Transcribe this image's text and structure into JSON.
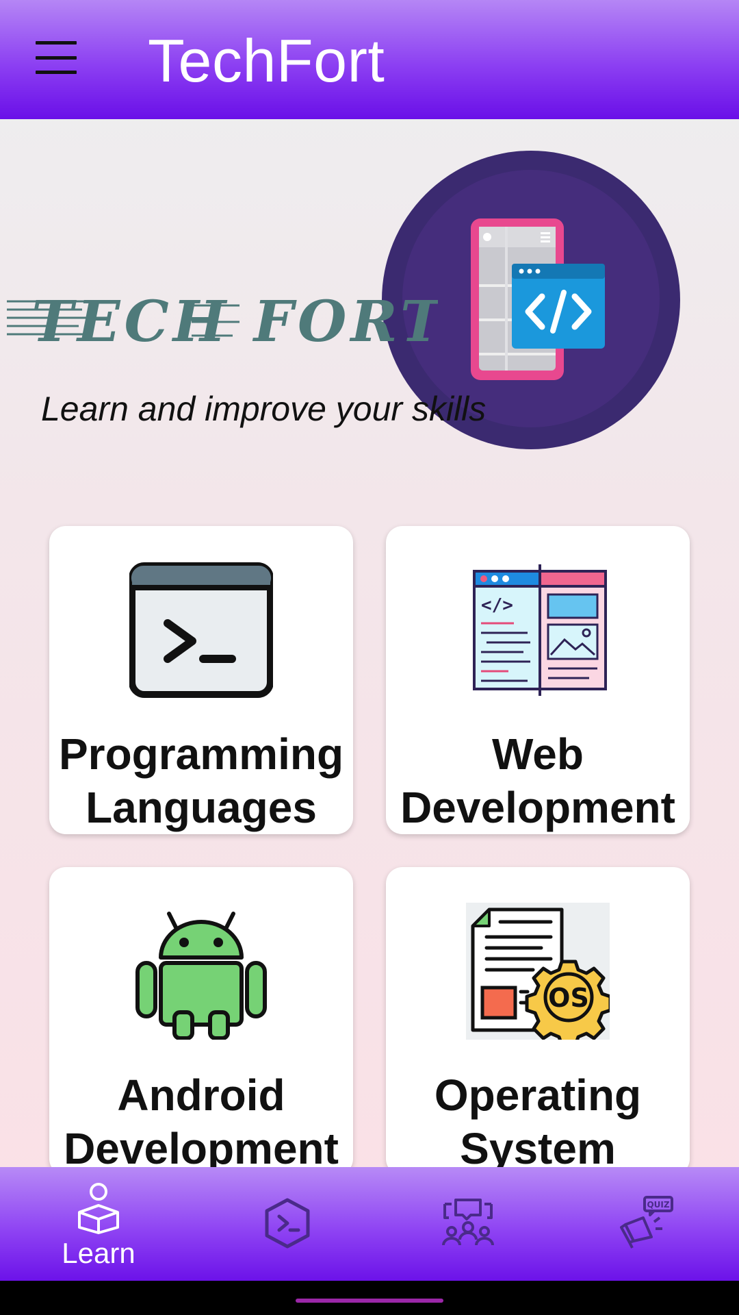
{
  "appbar": {
    "title": "TechFort",
    "menu_icon": "hamburger-menu-icon"
  },
  "hero": {
    "brand": "TECH FORT",
    "tagline": "Learn and improve your skills",
    "illustration": "mobile-code-icon"
  },
  "categories": [
    {
      "label": "Programming\nLanguages",
      "icon": "terminal-window-icon"
    },
    {
      "label": "Web\nDevelopment",
      "icon": "web-layout-icon"
    },
    {
      "label": "Android\nDevelopment",
      "icon": "android-robot-icon"
    },
    {
      "label": "Operating\nSystem",
      "icon": "os-document-gear-icon"
    }
  ],
  "bottom_nav": {
    "items": [
      {
        "label": "Learn",
        "icon": "learn-book-icon",
        "selected": true
      },
      {
        "label": "",
        "icon": "terminal-hexagon-icon",
        "selected": false
      },
      {
        "label": "",
        "icon": "community-chat-icon",
        "selected": false
      },
      {
        "label": "",
        "icon": "quiz-megaphone-icon",
        "selected": false
      }
    ]
  },
  "colors": {
    "appbar_top": "#b586f5",
    "appbar_bottom": "#6a0fe8",
    "brand_text": "#4f7a7a",
    "hero_circle": "#3b2a70",
    "nav_icon_inactive": "#4a2a8a"
  }
}
